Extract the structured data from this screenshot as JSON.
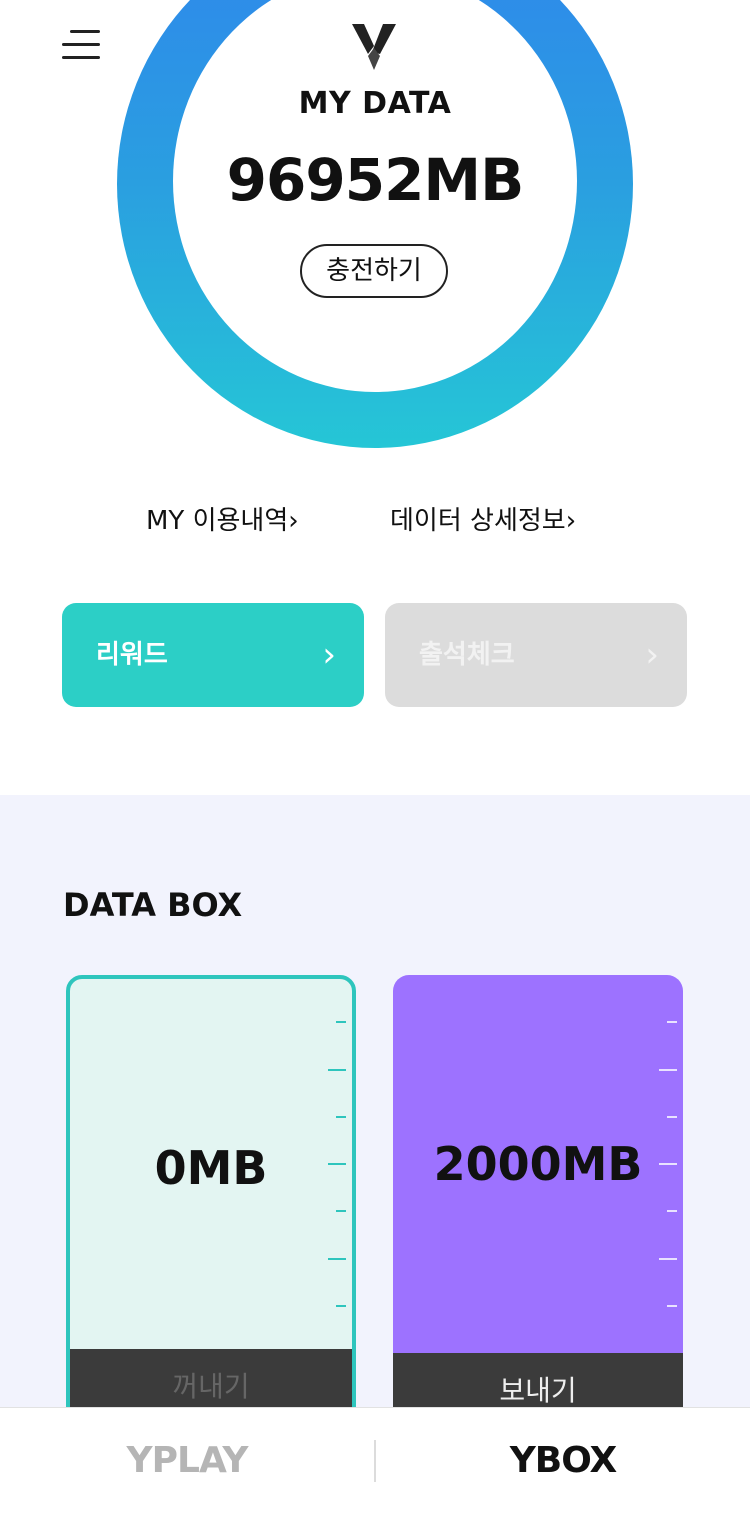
{
  "header": {
    "menu_icon": "hamburger-menu-icon",
    "logo_icon": "y-logo-icon"
  },
  "my_data": {
    "label": "MY DATA",
    "value": "96952MB",
    "charge_label": "충전하기"
  },
  "links": {
    "usage": "MY 이용내역",
    "detail": "데이터 상세정보"
  },
  "tiles": [
    {
      "label": "리워드",
      "color": "#2ccfc6"
    },
    {
      "label": "출석체크",
      "color": "#dcdcdc"
    }
  ],
  "data_box": {
    "title": "DATA BOX",
    "boxes": [
      {
        "value": "0MB",
        "action": "꺼내기",
        "color": "#e3f5f2"
      },
      {
        "value": "2000MB",
        "action": "보내기",
        "color": "#9d72ff"
      }
    ]
  },
  "tabbar": {
    "tabs": [
      "YPLAY",
      "YBOX"
    ],
    "active": "YBOX"
  },
  "colors": {
    "ring_top": "#2f86ec",
    "ring_bottom": "#25c6d6",
    "accent_teal": "#2ccfc6",
    "purple": "#9d72ff"
  }
}
